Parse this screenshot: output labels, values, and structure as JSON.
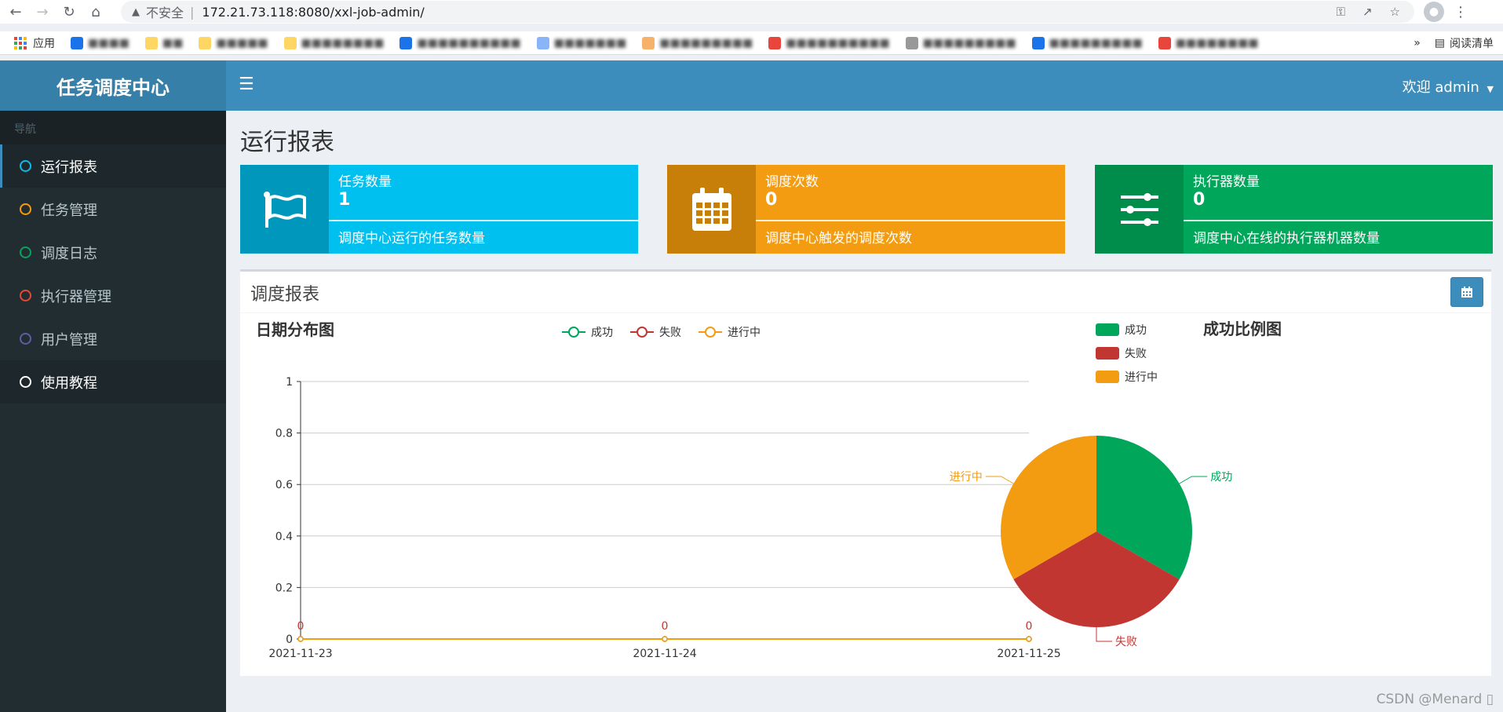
{
  "browser": {
    "insecure_label": "不安全",
    "url": "172.21.73.118:8080/xxl-job-admin/",
    "bookmarks": [
      "应用"
    ],
    "reading_list": "阅读清单",
    "more": "»"
  },
  "app": {
    "logo": "任务调度中心",
    "welcome": "欢迎 admin"
  },
  "sidebar": {
    "header": "导航",
    "items": [
      {
        "label": "运行报表",
        "color": "#00c0ef"
      },
      {
        "label": "任务管理",
        "color": "#f39c12"
      },
      {
        "label": "调度日志",
        "color": "#00a65a"
      },
      {
        "label": "执行器管理",
        "color": "#dd4b39"
      },
      {
        "label": "用户管理",
        "color": "#605ca8"
      },
      {
        "label": "使用教程",
        "color": "#ffffff"
      }
    ]
  },
  "page": {
    "title": "运行报表"
  },
  "info_boxes": [
    {
      "label": "任务数量",
      "value": "1",
      "desc": "调度中心运行的任务数量",
      "color": "#00c0ef",
      "icon_color": "#0097bc",
      "icon": "flag-icon"
    },
    {
      "label": "调度次数",
      "value": "0",
      "desc": "调度中心触发的调度次数",
      "color": "#f39c12",
      "icon_color": "#c87f0a",
      "icon": "calendar-icon"
    },
    {
      "label": "执行器数量",
      "value": "0",
      "desc": "调度中心在线的执行器机器数量",
      "color": "#00a65a",
      "icon_color": "#008d4c",
      "icon": "sliders-icon"
    }
  ],
  "report": {
    "title": "调度报表"
  },
  "chart_data": [
    {
      "type": "line",
      "title": "日期分布图",
      "x": [
        "2021-11-23",
        "2021-11-24",
        "2021-11-25"
      ],
      "series": [
        {
          "name": "成功",
          "values": [
            0,
            0,
            0
          ],
          "color": "#00a65a"
        },
        {
          "name": "失败",
          "values": [
            0,
            0,
            0
          ],
          "color": "#c23632"
        },
        {
          "name": "进行中",
          "values": [
            0,
            0,
            0
          ],
          "color": "#f39c12"
        }
      ],
      "ylim": [
        0,
        1
      ],
      "yticks": [
        "0",
        "0.2",
        "0.4",
        "0.6",
        "0.8",
        "1"
      ],
      "data_labels": [
        "0",
        "0",
        "0"
      ],
      "legend": "top-center",
      "grid": true
    },
    {
      "type": "pie",
      "title": "成功比例图",
      "slices": [
        {
          "name": "成功",
          "value": 1,
          "color": "#00a65a"
        },
        {
          "name": "失败",
          "value": 1,
          "color": "#c23632"
        },
        {
          "name": "进行中",
          "value": 1,
          "color": "#f39c12"
        }
      ],
      "legend": "top-left"
    }
  ],
  "watermark": "CSDN @Menard ▯"
}
